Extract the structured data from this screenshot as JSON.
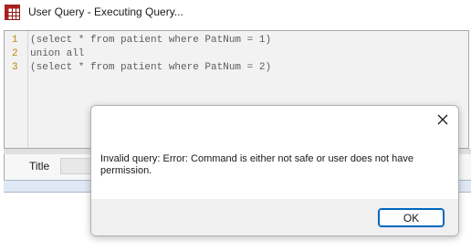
{
  "window": {
    "title": "User Query - Executing Query..."
  },
  "icons": {
    "app": "grid-app-icon",
    "close": "close-icon"
  },
  "editor": {
    "lines": [
      {
        "num": "1",
        "code": "(select * from patient where PatNum = 1)"
      },
      {
        "num": "2",
        "code": "union all"
      },
      {
        "num": "3",
        "code": "(select * from patient where PatNum = 2)"
      }
    ]
  },
  "results": {
    "title_label": "Title",
    "title_value": ""
  },
  "dialog": {
    "message": "Invalid query: Error: Command is either not safe or user does not have permission.",
    "ok_label": "OK"
  },
  "colors": {
    "accent": "#0067c0",
    "line_number": "#b8860b",
    "code_text": "#5c5c5c"
  }
}
